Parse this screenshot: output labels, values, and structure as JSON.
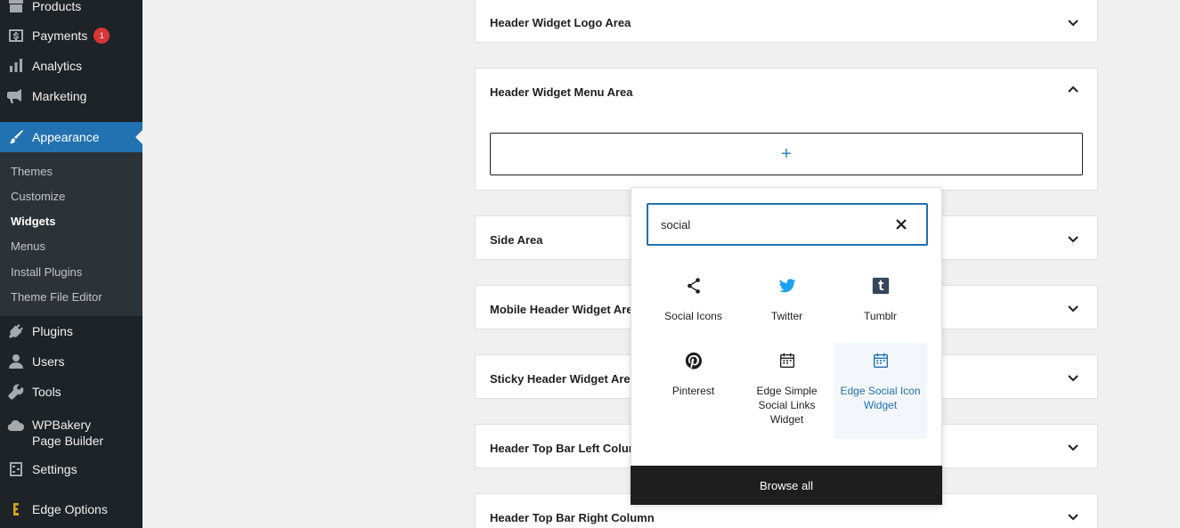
{
  "sidebar": {
    "items": [
      {
        "label": "Products",
        "icon": "archive-icon"
      },
      {
        "label": "Payments",
        "icon": "dollar-icon",
        "badge": "1"
      },
      {
        "label": "Analytics",
        "icon": "bar-chart-icon"
      },
      {
        "label": "Marketing",
        "icon": "megaphone-icon"
      },
      {
        "label": "Appearance",
        "icon": "paintbrush-icon"
      },
      {
        "label": "Plugins",
        "icon": "plug-icon"
      },
      {
        "label": "Users",
        "icon": "user-icon"
      },
      {
        "label": "Tools",
        "icon": "wrench-icon"
      },
      {
        "label": "WPBakery Page Builder",
        "icon": "cloud-icon"
      },
      {
        "label": "Settings",
        "icon": "sliders-icon"
      },
      {
        "label": "Edge Options",
        "icon": "edge-icon"
      }
    ],
    "submenu": [
      "Themes",
      "Customize",
      "Widgets",
      "Menus",
      "Install Plugins",
      "Theme File Editor"
    ],
    "accent": "#2271b1"
  },
  "widget_areas": [
    "Header Widget Logo Area",
    "Header Widget Menu Area",
    "Side Area",
    "Mobile Header Widget Area",
    "Sticky Header Widget Area",
    "Header Top Bar Left Column",
    "Header Top Bar Right Column"
  ],
  "add_block_label": "+",
  "inserter": {
    "search_value": "social",
    "blocks": [
      {
        "label": "Social Icons",
        "icon": "share-icon"
      },
      {
        "label": "Twitter",
        "icon": "twitter-icon"
      },
      {
        "label": "Tumblr",
        "icon": "tumblr-icon"
      },
      {
        "label": "Pinterest",
        "icon": "pinterest-icon"
      },
      {
        "label": "Edge Simple Social Links Widget",
        "icon": "calendar-icon"
      },
      {
        "label": "Edge Social Icon Widget",
        "icon": "calendar-icon"
      }
    ],
    "browse_all": "Browse all"
  }
}
